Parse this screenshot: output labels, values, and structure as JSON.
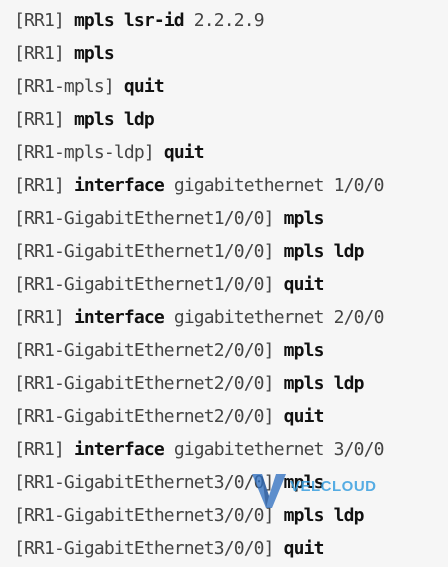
{
  "console": {
    "lines": [
      {
        "prompt": "[RR1]",
        "command": "mpls lsr-id",
        "args": "2.2.2.9"
      },
      {
        "prompt": "[RR1]",
        "command": "mpls",
        "args": ""
      },
      {
        "prompt": "[RR1-mpls]",
        "command": "quit",
        "args": ""
      },
      {
        "prompt": "[RR1]",
        "command": "mpls ldp",
        "args": ""
      },
      {
        "prompt": "[RR1-mpls-ldp]",
        "command": "quit",
        "args": ""
      },
      {
        "prompt": "[RR1]",
        "command": "interface",
        "args": "gigabitethernet 1/0/0"
      },
      {
        "prompt": "[RR1-GigabitEthernet1/0/0]",
        "command": "mpls",
        "args": ""
      },
      {
        "prompt": "[RR1-GigabitEthernet1/0/0]",
        "command": "mpls ldp",
        "args": ""
      },
      {
        "prompt": "[RR1-GigabitEthernet1/0/0]",
        "command": "quit",
        "args": ""
      },
      {
        "prompt": "[RR1]",
        "command": "interface",
        "args": "gigabitethernet 2/0/0"
      },
      {
        "prompt": "[RR1-GigabitEthernet2/0/0]",
        "command": "mpls",
        "args": ""
      },
      {
        "prompt": "[RR1-GigabitEthernet2/0/0]",
        "command": "mpls ldp",
        "args": ""
      },
      {
        "prompt": "[RR1-GigabitEthernet2/0/0]",
        "command": "quit",
        "args": ""
      },
      {
        "prompt": "[RR1]",
        "command": "interface",
        "args": "gigabitethernet 3/0/0"
      },
      {
        "prompt": "[RR1-GigabitEthernet3/0/0]",
        "command": "mpls",
        "args": ""
      },
      {
        "prompt": "[RR1-GigabitEthernet3/0/0]",
        "command": "mpls ldp",
        "args": ""
      },
      {
        "prompt": "[RR1-GigabitEthernet3/0/0]",
        "command": "quit",
        "args": ""
      }
    ]
  },
  "watermark": {
    "text": "VELCLOUD",
    "color": "#3aa0e0"
  }
}
